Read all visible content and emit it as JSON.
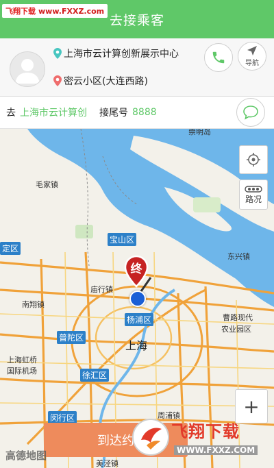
{
  "watermark_top": {
    "site": "飞翔下载",
    "url": "www.FXXZ.com"
  },
  "header": {
    "title": "去接乘客"
  },
  "passenger": {
    "pickup_address": "上海市云计算创新展示中心",
    "dropoff_address": "密云小区(大连西路)"
  },
  "actions": {
    "navigate_label": "导航"
  },
  "destination": {
    "go_label": "去",
    "destination_text": "上海市云计算创",
    "tail_label": "接尾号",
    "tail_number": "8888"
  },
  "map": {
    "labels": {
      "tongzhou": "崇明岛",
      "maojia": "毛家镇",
      "baoshan": "宝山区",
      "dongxing": "东兴镇",
      "jiading_qu": "定区",
      "miaoxing": "庙行镇",
      "nanxiang": "南翔镇",
      "yangpu": "杨浦区",
      "caolu": "曹路现代",
      "caolu2": "农业园区",
      "putuo": "普陀区",
      "shanghai": "上海",
      "hongqiao": "上海虹桥",
      "hongqiao2": "国际机场",
      "xuhui": "徐汇区",
      "zhoupu": "周浦镇",
      "minhang": "闵行区",
      "meilong": "美泾镇"
    },
    "marker_label": "终",
    "traffic_label": "路况",
    "zoom_in": "+",
    "logo": "高德地图"
  },
  "bottom": {
    "arrive_label": "到达约"
  },
  "watermark_corner": {
    "title": "飞翔下载",
    "url": "WWW.FXXZ.COM"
  },
  "colors": {
    "brand_green": "#5fc868",
    "accent_orange": "#ee8b5c",
    "water": "#6eb6ea",
    "road": "#f0a23a"
  }
}
